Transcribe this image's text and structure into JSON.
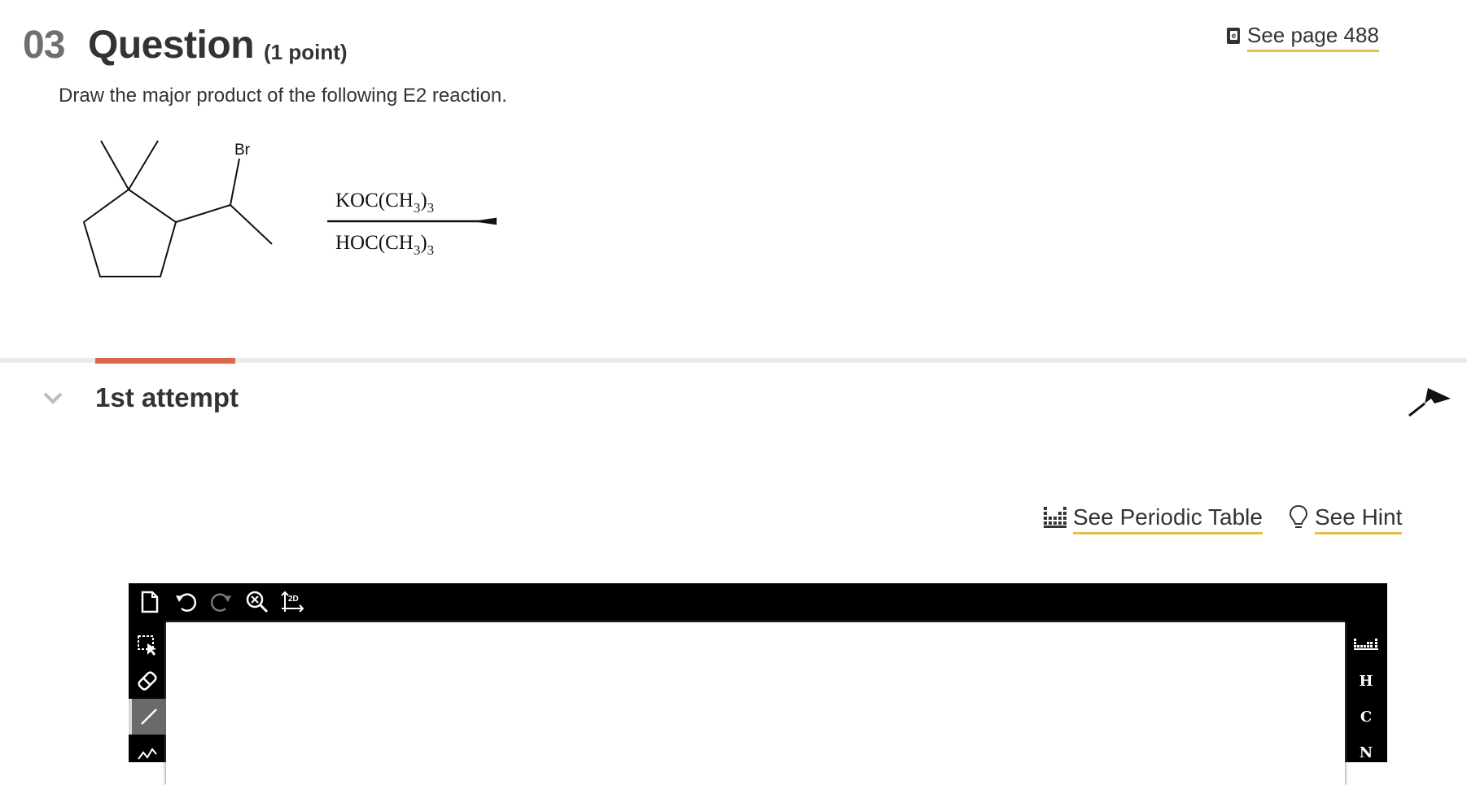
{
  "question": {
    "number": "03",
    "title": "Question",
    "points": "(1 point)",
    "see_page": "See page 488",
    "prompt": "Draw the major product of the following E2 reaction."
  },
  "reaction": {
    "substituent_label": "Br",
    "reagent_top_main": "KOC(CH",
    "reagent_top_sub": "3",
    "reagent_top_close": ")",
    "reagent_top_sub2": "3",
    "reagent_bottom_main": "HOC(CH",
    "reagent_bottom_sub": "3",
    "reagent_bottom_close": ")",
    "reagent_bottom_sub2": "3"
  },
  "attempt": {
    "label": "1st attempt"
  },
  "tools": {
    "periodic_table": "See Periodic Table",
    "hint": "See Hint"
  },
  "editor": {
    "top_toolbar": [
      "new-document-icon",
      "undo-icon",
      "redo-icon",
      "zoom-clear-icon",
      "2d-cleanup-icon"
    ],
    "cleanup_label": "2D",
    "left_toolbar": [
      "selection-icon",
      "eraser-icon",
      "single-bond-icon",
      "chain-icon"
    ],
    "elements": [
      "H",
      "C",
      "N"
    ]
  },
  "colors": {
    "accent_underline": "#e0c04a",
    "attempt_tab_accent": "#d9684e",
    "editor_frame": "#000000"
  }
}
